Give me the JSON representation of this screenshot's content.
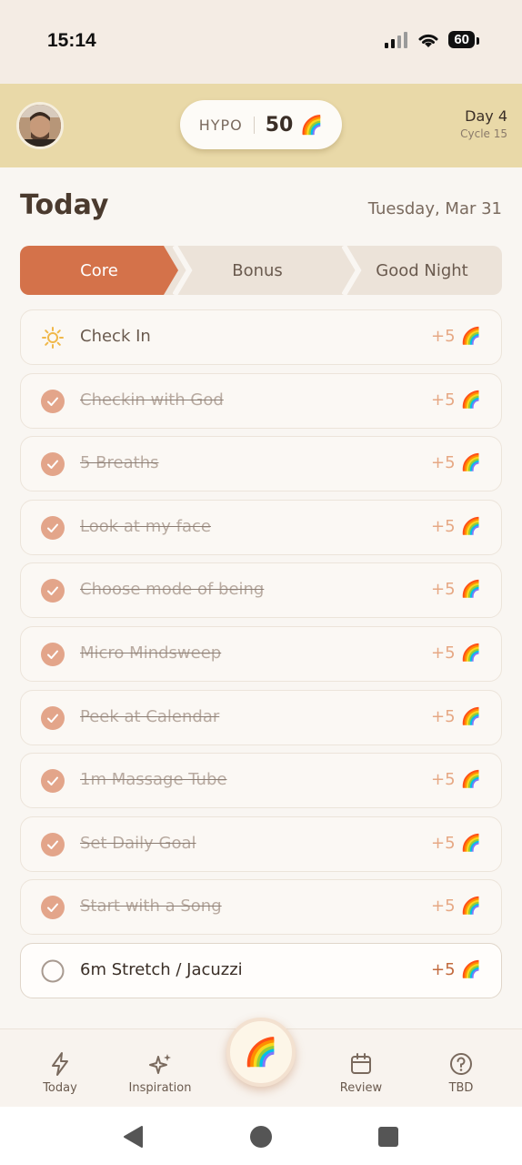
{
  "status_bar": {
    "time": "15:14",
    "battery": "60"
  },
  "header": {
    "hypo_label": "HYPO",
    "hypo_score": "50",
    "rainbow_emoji": "🌈",
    "day_label": "Day 4",
    "cycle_label": "Cycle 15"
  },
  "page": {
    "title": "Today",
    "date": "Tuesday, Mar 31"
  },
  "segments": [
    "Core",
    "Bonus",
    "Good Night"
  ],
  "tasks": [
    {
      "label": "Check In",
      "points": "+5",
      "state": "sun"
    },
    {
      "label": "Checkin with God",
      "points": "+5",
      "state": "done"
    },
    {
      "label": "5 Breaths",
      "points": "+5",
      "state": "done"
    },
    {
      "label": "Look at my face",
      "points": "+5",
      "state": "done"
    },
    {
      "label": "Choose mode of being",
      "points": "+5",
      "state": "done"
    },
    {
      "label": "Micro Mindsweep",
      "points": "+5",
      "state": "done"
    },
    {
      "label": "Peek at Calendar",
      "points": "+5",
      "state": "done"
    },
    {
      "label": "1m Massage Tube",
      "points": "+5",
      "state": "done"
    },
    {
      "label": "Set Daily Goal",
      "points": "+5",
      "state": "done"
    },
    {
      "label": "Start with a Song",
      "points": "+5",
      "state": "done"
    },
    {
      "label": "6m Stretch / Jacuzzi",
      "points": "+5",
      "state": "todo"
    }
  ],
  "nav": {
    "today": "Today",
    "inspiration": "Inspiration",
    "review": "Review",
    "tbd": "TBD",
    "center_emoji": "🌈"
  },
  "colors": {
    "accent": "#d4724a",
    "header_bg": "#e9d9a8",
    "check_fill": "#e3a58a"
  },
  "icons": [
    "signal-icon",
    "wifi-icon",
    "battery-icon",
    "sun-icon",
    "check-circle-icon",
    "empty-circle-icon",
    "lightning-icon",
    "sparkles-icon",
    "calendar-icon",
    "help-circle-icon",
    "back-icon",
    "home-icon",
    "recents-icon"
  ]
}
